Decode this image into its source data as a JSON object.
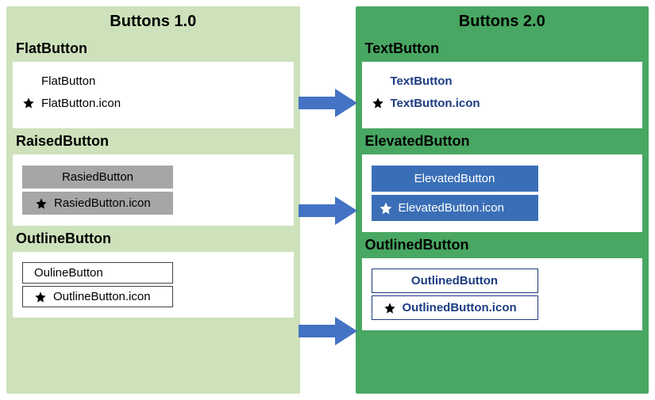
{
  "left": {
    "title": "Buttons 1.0",
    "flat": {
      "heading": "FlatButton",
      "plain": "FlatButton",
      "withIcon": "FlatButton.icon"
    },
    "raised": {
      "heading": "RaisedButton",
      "plain": "RasiedButton",
      "withIcon": "RasiedButton.icon"
    },
    "outline": {
      "heading": "OutlineButton",
      "plain": "OulineButton",
      "withIcon": "OutlineButton.icon"
    }
  },
  "right": {
    "title": "Buttons 2.0",
    "text": {
      "heading": "TextButton",
      "plain": "TextButton",
      "withIcon": "TextButton.icon"
    },
    "elevated": {
      "heading": "ElevatedButton",
      "plain": "ElevatedButton",
      "withIcon": "ElevatedButton.icon"
    },
    "outlined": {
      "heading": "OutlinedButton",
      "plain": "OutlinedButton",
      "withIcon": "OutlinedButton.icon"
    }
  },
  "colors": {
    "leftPanel": "#cde2bb",
    "rightPanel": "#48a762",
    "arrow": "#4472c4",
    "raisedGrey": "#a6a6a6",
    "elevatedBlue": "#3a6fb7",
    "textBlue": "#1c3c82"
  }
}
